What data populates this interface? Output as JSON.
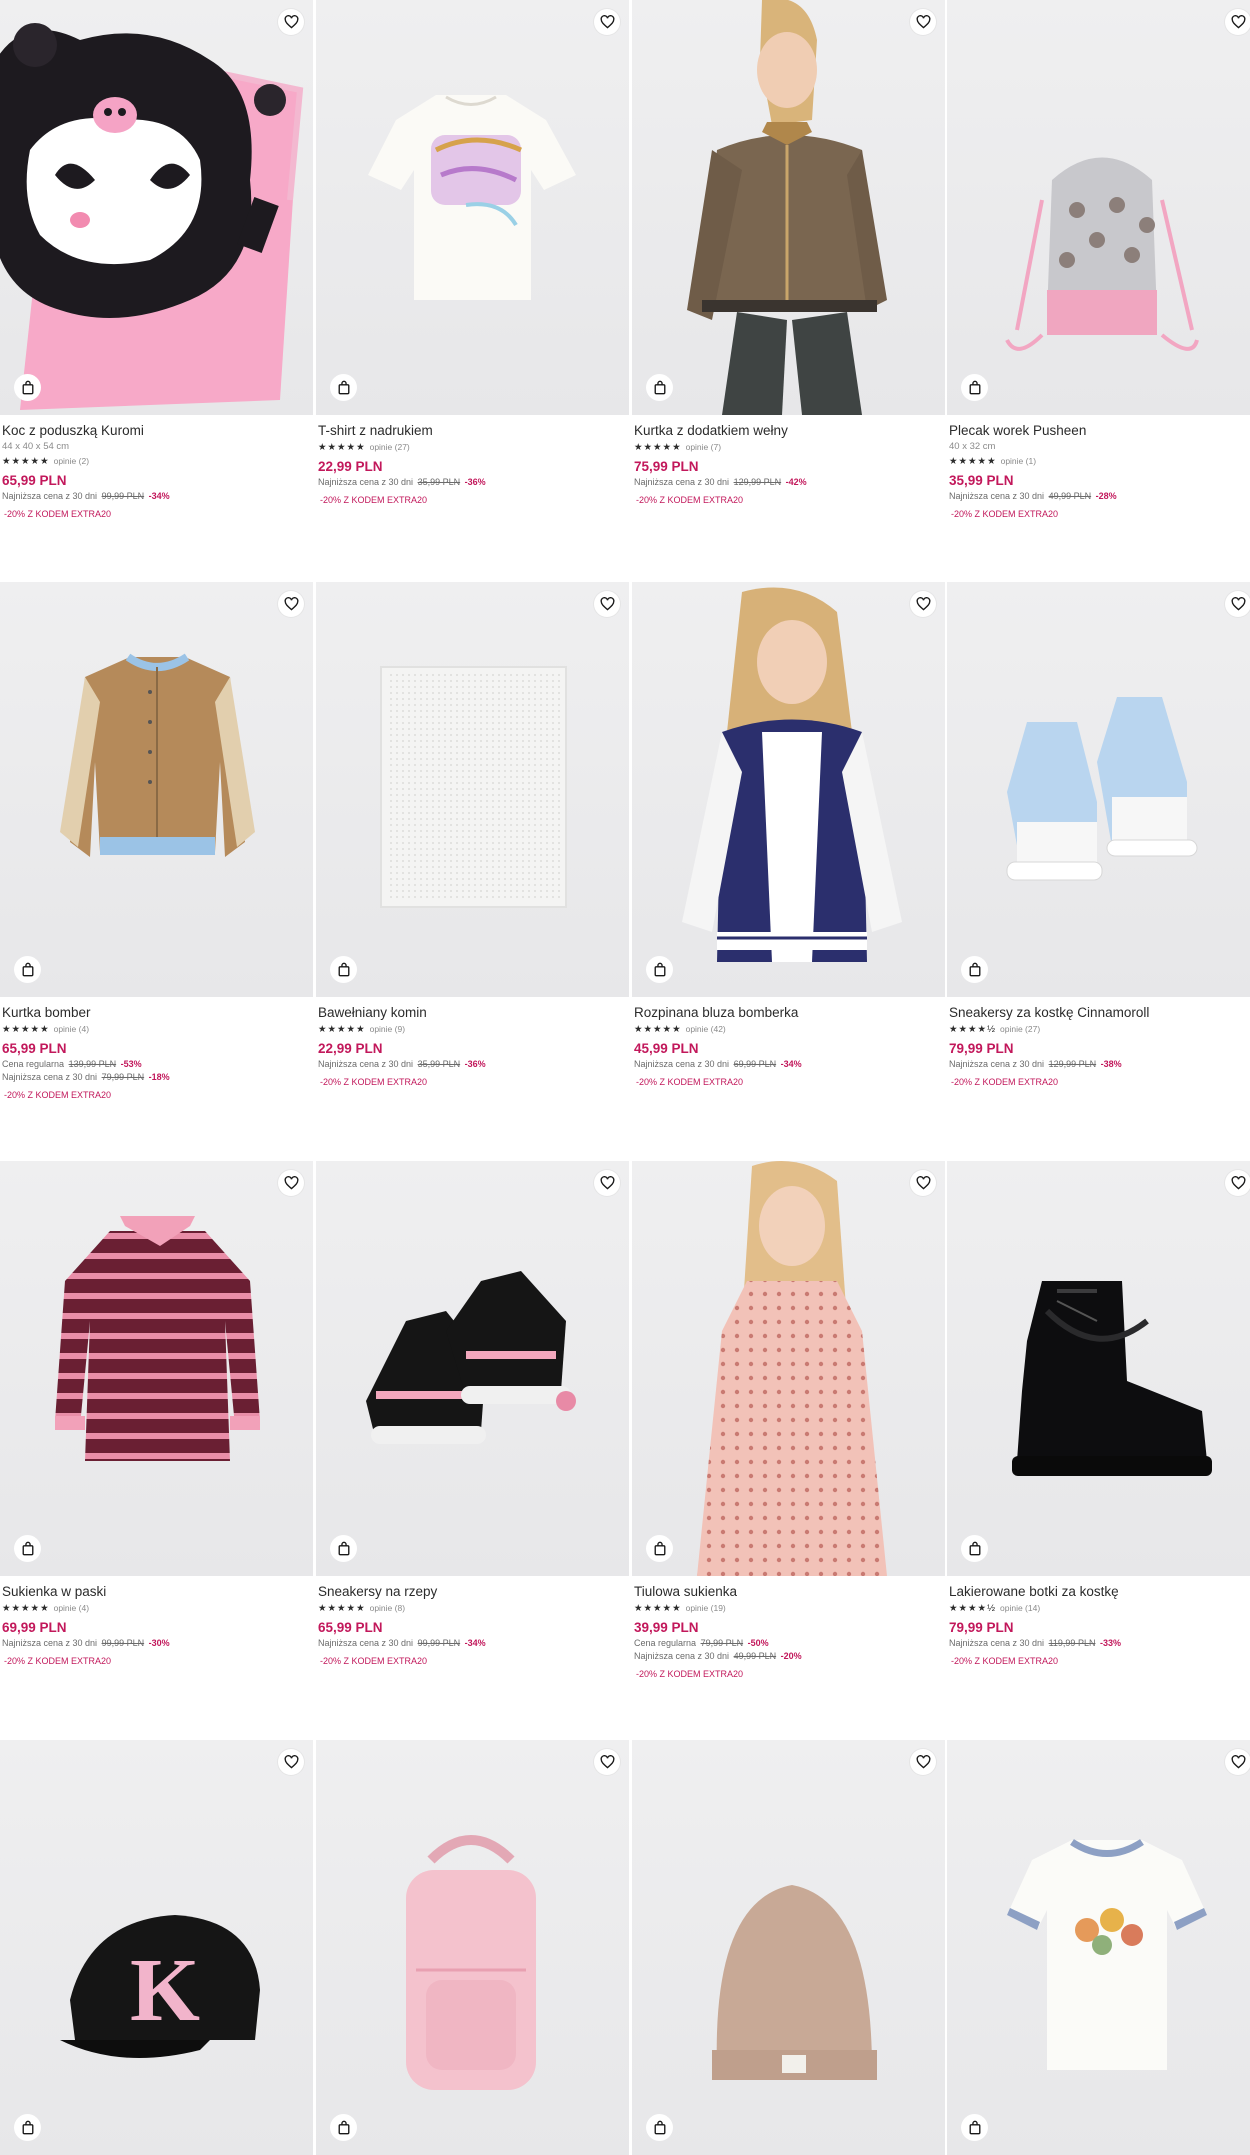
{
  "products": [
    {
      "name": "Koc z poduszką Kuromi",
      "dims": "44 x 40 x 54 cm",
      "stars": "★★★★★",
      "reviews": "opinie (2)",
      "price": "65,99 PLN",
      "history": [
        {
          "label": "Najniższa cena z 30 dni",
          "old": "99,99 PLN",
          "disc": "-34%"
        }
      ],
      "promo": "-20% Z KODEM EXTRA20",
      "image": "kuromi-blanket"
    },
    {
      "name": "T-shirt z nadrukiem",
      "stars": "★★★★★",
      "reviews": "opinie (27)",
      "price": "22,99 PLN",
      "history": [
        {
          "label": "Najniższa cena z 30 dni",
          "old": "35,99 PLN",
          "disc": "-36%"
        }
      ],
      "promo": "-20% Z KODEM EXTRA20",
      "image": "tshirt-print"
    },
    {
      "name": "Kurtka z dodatkiem wełny",
      "stars": "★★★★★",
      "reviews": "opinie (7)",
      "price": "75,99 PLN",
      "history": [
        {
          "label": "Najniższa cena z 30 dni",
          "old": "129,99 PLN",
          "disc": "-42%"
        }
      ],
      "promo": "-20% Z KODEM EXTRA20",
      "image": "wool-jacket"
    },
    {
      "name": "Plecak worek Pusheen",
      "dims": "40 x 32 cm",
      "stars": "★★★★★",
      "reviews": "opinie (1)",
      "price": "35,99 PLN",
      "history": [
        {
          "label": "Najniższa cena z 30 dni",
          "old": "49,99 PLN",
          "disc": "-28%"
        }
      ],
      "promo": "-20% Z KODEM EXTRA20",
      "image": "pusheen-bag"
    },
    {
      "name": "Kurtka bomber",
      "stars": "★★★★★",
      "reviews": "opinie (4)",
      "price": "65,99 PLN",
      "history": [
        {
          "label": "Cena regularna",
          "old": "139,99 PLN",
          "disc": "-53%"
        },
        {
          "label": "Najniższa cena z 30 dni",
          "old": "79,99 PLN",
          "disc": "-18%"
        }
      ],
      "promo": "-20% Z KODEM EXTRA20",
      "image": "bomber-jacket"
    },
    {
      "name": "Bawełniany komin",
      "stars": "★★★★★",
      "reviews": "opinie (9)",
      "price": "22,99 PLN",
      "history": [
        {
          "label": "Najniższa cena z 30 dni",
          "old": "35,99 PLN",
          "disc": "-36%"
        }
      ],
      "promo": "-20% Z KODEM EXTRA20",
      "image": "cotton-snood"
    },
    {
      "name": "Rozpinana bluza bomberka",
      "stars": "★★★★★",
      "reviews": "opinie (42)",
      "price": "45,99 PLN",
      "history": [
        {
          "label": "Najniższa cena z 30 dni",
          "old": "69,99 PLN",
          "disc": "-34%"
        }
      ],
      "promo": "-20% Z KODEM EXTRA20",
      "image": "varsity-sweatshirt"
    },
    {
      "name": "Sneakersy za kostkę Cinnamoroll",
      "stars": "★★★★½",
      "reviews": "opinie (27)",
      "price": "79,99 PLN",
      "history": [
        {
          "label": "Najniższa cena z 30 dni",
          "old": "129,99 PLN",
          "disc": "-38%"
        }
      ],
      "promo": "-20% Z KODEM EXTRA20",
      "image": "cinnamoroll-sneakers"
    },
    {
      "name": "Sukienka w paski",
      "stars": "★★★★★",
      "reviews": "opinie (4)",
      "price": "69,99 PLN",
      "history": [
        {
          "label": "Najniższa cena z 30 dni",
          "old": "99,99 PLN",
          "disc": "-30%"
        }
      ],
      "promo": "-20% Z KODEM EXTRA20",
      "image": "striped-dress"
    },
    {
      "name": "Sneakersy na rzepy",
      "stars": "★★★★★",
      "reviews": "opinie (8)",
      "price": "65,99 PLN",
      "history": [
        {
          "label": "Najniższa cena z 30 dni",
          "old": "99,99 PLN",
          "disc": "-34%"
        }
      ],
      "promo": "-20% Z KODEM EXTRA20",
      "image": "velcro-sneakers"
    },
    {
      "name": "Tiulowa sukienka",
      "stars": "★★★★★",
      "reviews": "opinie (19)",
      "price": "39,99 PLN",
      "history": [
        {
          "label": "Cena regularna",
          "old": "79,99 PLN",
          "disc": "-50%"
        },
        {
          "label": "Najniższa cena z 30 dni",
          "old": "49,99 PLN",
          "disc": "-20%"
        }
      ],
      "promo": "-20% Z KODEM EXTRA20",
      "image": "tulle-dress"
    },
    {
      "name": "Lakierowane botki za kostkę",
      "stars": "★★★★½",
      "reviews": "opinie (14)",
      "price": "79,99 PLN",
      "history": [
        {
          "label": "Najniższa cena z 30 dni",
          "old": "119,99 PLN",
          "disc": "-33%"
        }
      ],
      "promo": "-20% Z KODEM EXTRA20",
      "image": "patent-boots"
    },
    {
      "image": "kuromi-cap"
    },
    {
      "image": "pink-backpack"
    },
    {
      "image": "beanie"
    },
    {
      "image": "flower-tshirt"
    }
  ],
  "icons": {
    "wishlist": "heart-icon",
    "add_to_bag": "shopping-bag-icon"
  },
  "colors": {
    "price": "#c2185b",
    "promo": "#c2185b",
    "text": "#2b2b2b",
    "muted": "#8a8a8a",
    "photo_bg": "#ececee"
  }
}
